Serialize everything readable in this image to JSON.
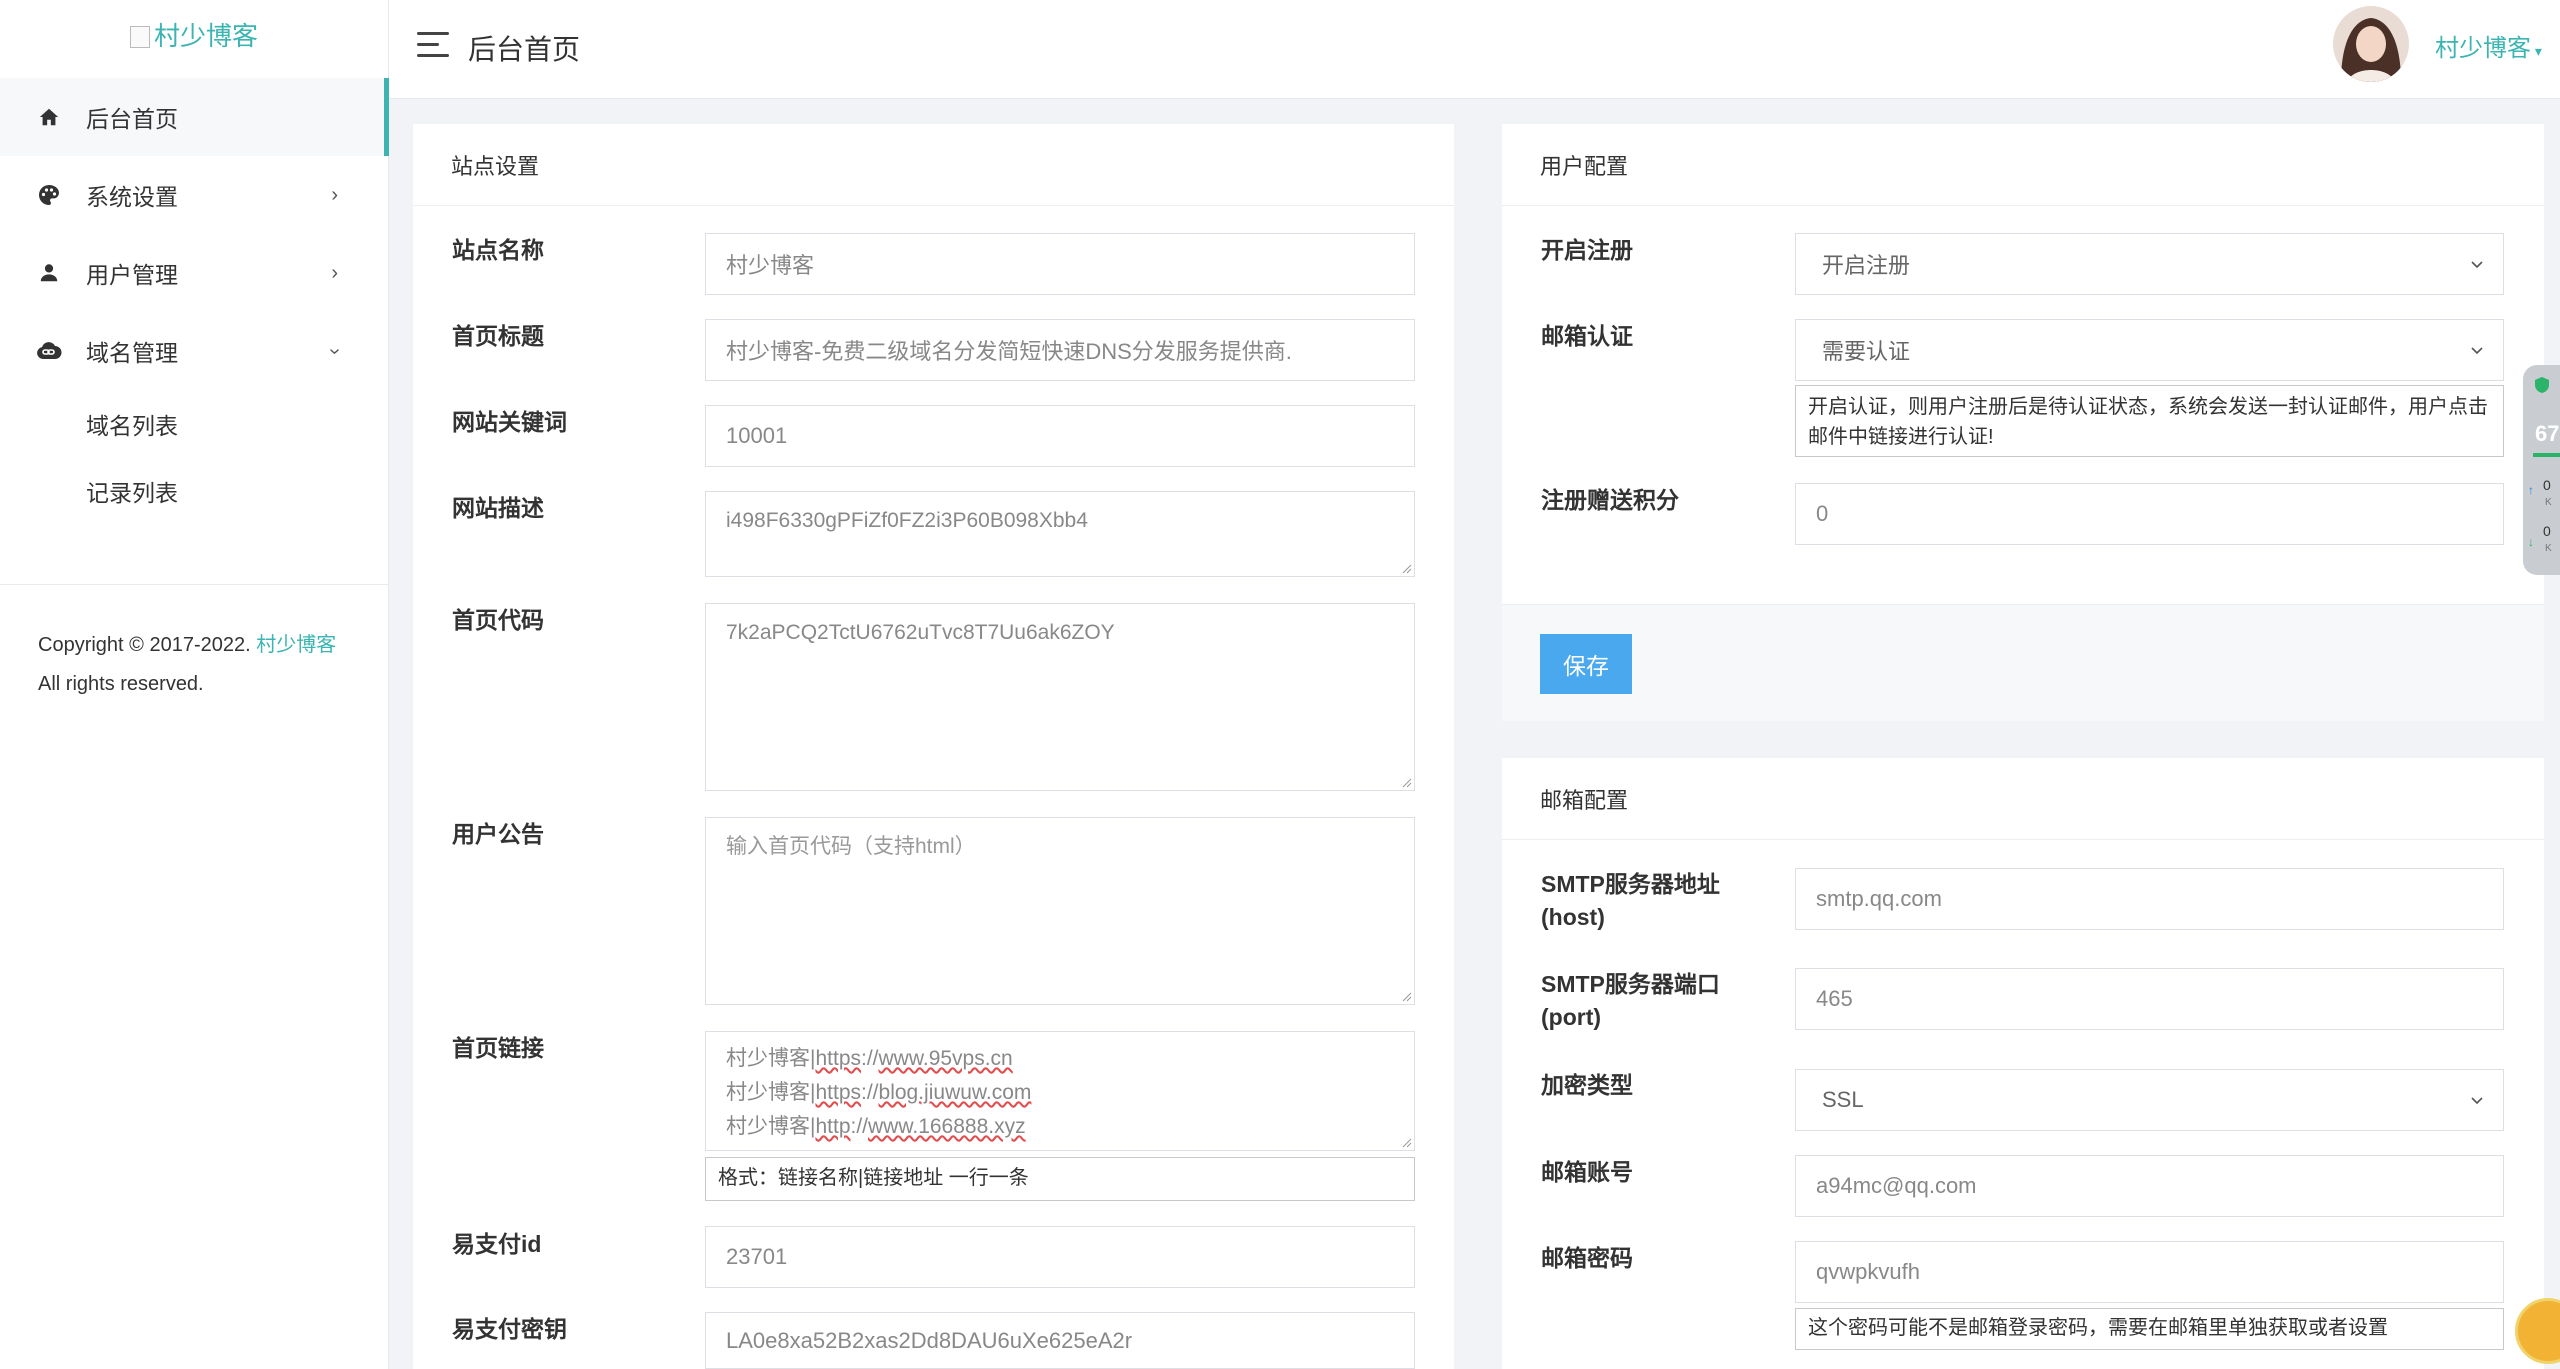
{
  "brand": {
    "logo_alt": "村少博客",
    "accent": "#3bb4b2"
  },
  "header": {
    "title": "后台首页",
    "user_name": "村少博客"
  },
  "sidebar": {
    "items": [
      {
        "label": "后台首页",
        "icon": "home-icon"
      },
      {
        "label": "系统设置",
        "icon": "palette-icon"
      },
      {
        "label": "用户管理",
        "icon": "user-icon"
      },
      {
        "label": "域名管理",
        "icon": "cloud-link-icon"
      }
    ],
    "subitems": [
      "域名列表",
      "记录列表"
    ],
    "copyright_prefix": "Copyright © 2017-2022.",
    "copyright_brand": "村少博客",
    "copyright_suffix": "All rights reserved."
  },
  "site_settings": {
    "title": "站点设置",
    "fields": {
      "site_name": {
        "label": "站点名称",
        "value": "村少博客"
      },
      "home_title": {
        "label": "首页标题",
        "value": "村少博客-免费二级域名分发简短快速DNS分发服务提供商."
      },
      "keywords": {
        "label": "网站关键词",
        "value": "10001"
      },
      "description": {
        "label": "网站描述",
        "value": "i498F6330gPFiZf0FZ2i3P60B098Xbb4"
      },
      "home_code": {
        "label": "首页代码",
        "value": "7k2aPCQ2TctU6762uTvc8T7Uu6ak6ZOY"
      },
      "notice": {
        "label": "用户公告",
        "placeholder": "输入首页代码（支持html）"
      },
      "home_links": {
        "label": "首页链接",
        "lines": [
          {
            "name": "村少博客",
            "scheme": "https",
            "host": "www.95vps.cn"
          },
          {
            "name": "村少博客",
            "scheme": "https",
            "host": "blog.jiuwuw.com"
          },
          {
            "name": "村少博客",
            "scheme": "http",
            "host": "www.166888.xyz"
          }
        ],
        "hint": "格式：链接名称|链接地址 一行一条"
      },
      "pay_id": {
        "label": "易支付id",
        "value": "23701"
      },
      "pay_key": {
        "label": "易支付密钥",
        "value": "LA0e8xa52B2xas2Dd8DAU6uXe625eA2r"
      }
    }
  },
  "user_config": {
    "title": "用户配置",
    "register": {
      "label": "开启注册",
      "value": "开启注册"
    },
    "email_verify": {
      "label": "邮箱认证",
      "value": "需要认证",
      "hint": "开启认证，则用户注册后是待认证状态，系统会发送一封认证邮件，用户点击邮件中链接进行认证!"
    },
    "bonus": {
      "label": "注册赠送积分",
      "value": "0"
    },
    "save_label": "保存"
  },
  "mail_config": {
    "title": "邮箱配置",
    "host": {
      "label_line1": "SMTP服务器地址",
      "label_line2": "(host)",
      "value": "smtp.qq.com"
    },
    "port": {
      "label_line1": "SMTP服务器端口",
      "label_line2": "(port)",
      "value": "465"
    },
    "encryption": {
      "label": "加密类型",
      "value": "SSL"
    },
    "account": {
      "label": "邮箱账号",
      "value": "a94mc@qq.com"
    },
    "password": {
      "label": "邮箱密码",
      "value": "qvwpkvufh",
      "hint": "这个密码可能不是邮箱登录密码，需要在邮箱里单独获取或者设置"
    }
  },
  "widgets": {
    "net_value": "67",
    "net_up": "0",
    "net_down": "0",
    "net_unit": "K"
  }
}
